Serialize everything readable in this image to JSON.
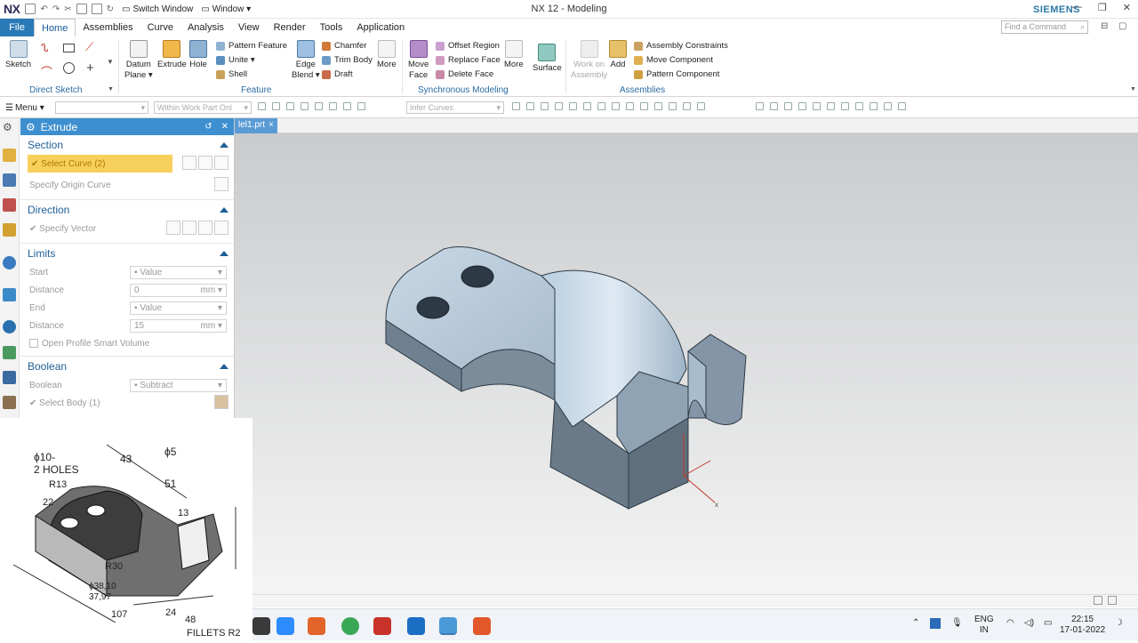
{
  "window": {
    "app_logo": "NX",
    "title": "NX 12 - Modeling",
    "brand": "SIEMENS",
    "switch_window": "Switch Window",
    "window_menu": "Window ▾"
  },
  "menubar": {
    "file": "File",
    "tabs": [
      "Home",
      "Assemblies",
      "Curve",
      "Analysis",
      "View",
      "Render",
      "Tools",
      "Application"
    ],
    "find_placeholder": "Find a Command"
  },
  "ribbon": {
    "direct_sketch": {
      "label": "Direct Sketch",
      "sketch": "Sketch"
    },
    "feature": {
      "label": "Feature",
      "datum_plane": "Datum",
      "datum_plane2": "Plane ▾",
      "extrude": "Extrude",
      "hole": "Hole",
      "pattern_feature": "Pattern Feature",
      "unite": "Unite ▾",
      "shell": "Shell",
      "edge_blend": "Edge",
      "edge_blend2": "Blend ▾",
      "chamfer": "Chamfer",
      "trim_body": "Trim Body",
      "draft": "Draft",
      "more": "More"
    },
    "synchronous": {
      "label": "Synchronous Modeling",
      "move_face": "Move",
      "move_face2": "Face",
      "offset_region": "Offset Region",
      "replace_face": "Replace Face",
      "delete_face": "Delete Face",
      "more": "More",
      "surface": "Surface"
    },
    "assemblies": {
      "label": "Assemblies",
      "work_on": "Work on",
      "work_on2": "Assembly",
      "add": "Add",
      "assembly_constraints": "Assembly Constraints",
      "move_component": "Move Component",
      "pattern_component": "Pattern Component"
    }
  },
  "toolbar2": {
    "menu": "Menu ▾",
    "combo1": "",
    "combo2": "Within Work Part Onl",
    "combo3": "Infer Curves"
  },
  "dialog": {
    "title": "Extrude",
    "section": {
      "header": "Section",
      "select_curve": "Select Curve (2)",
      "origin_curve": "Specify Origin Curve"
    },
    "direction": {
      "header": "Direction",
      "vector": "Specify Vector"
    },
    "limits": {
      "header": "Limits",
      "start_label": "Start",
      "start_value": "Value",
      "distance1_label": "Distance",
      "distance1_value": "0",
      "distance1_unit": "mm",
      "end_label": "End",
      "end_value": "Value",
      "distance2_label": "Distance",
      "distance2_value": "15",
      "distance2_unit": "mm",
      "open_profile": "Open Profile Smart Volume"
    },
    "boolean": {
      "header": "Boolean",
      "boolean_label": "Boolean",
      "boolean_value": "Subtract",
      "select_body": "Select Body (1)"
    }
  },
  "document_tab": {
    "name": "lel1.prt",
    "close": "×"
  },
  "sketch_overlay": {
    "labels": [
      "ϕ10-",
      "2 HOLES",
      "R13",
      "43",
      "ϕ5",
      "51",
      "13",
      "22",
      "R30",
      "ϕ38,10",
      "37,97",
      "107",
      "24",
      "48",
      "FILLETS R2"
    ]
  },
  "taskbar": {
    "lang_top": "ENG",
    "lang_bottom": "IN",
    "time": "22:15",
    "date": "17-01-2022"
  },
  "colors": {
    "accent": "#3d8fcf",
    "file_tab": "#2a7ab8",
    "selection": "#f7cf5c",
    "brand": "#2b78a8",
    "model": "#8fa3b5"
  }
}
